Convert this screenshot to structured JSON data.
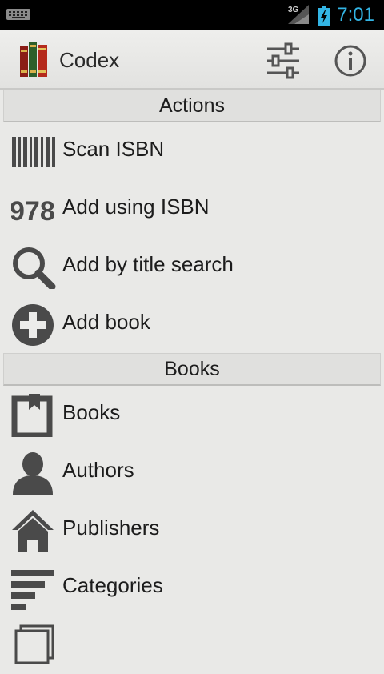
{
  "status_bar": {
    "network": "3G",
    "time": "7:01",
    "icons": [
      "keyboard-icon",
      "signal-icon",
      "battery-charging-icon"
    ]
  },
  "action_bar": {
    "app_title": "Codex",
    "icons": [
      "books-logo-icon",
      "settings-sliders-icon",
      "info-icon"
    ]
  },
  "actions_section": {
    "title": "Actions",
    "items": [
      {
        "label": "Scan ISBN",
        "icon": "barcode-icon"
      },
      {
        "label": "Add using ISBN",
        "icon": "isbn-978-icon",
        "icon_text": "978"
      },
      {
        "label": "Add by title search",
        "icon": "search-icon"
      },
      {
        "label": "Add book",
        "icon": "add-circle-icon"
      }
    ]
  },
  "books_section": {
    "title": "Books",
    "items": [
      {
        "label": "Books",
        "icon": "book-icon"
      },
      {
        "label": "Authors",
        "icon": "person-icon"
      },
      {
        "label": "Publishers",
        "icon": "home-icon"
      },
      {
        "label": "Categories",
        "icon": "categories-icon"
      }
    ]
  },
  "colors": {
    "accent": "#33b5e5",
    "background": "#e9e9e7",
    "icon_gray": "#4a4a4a"
  }
}
